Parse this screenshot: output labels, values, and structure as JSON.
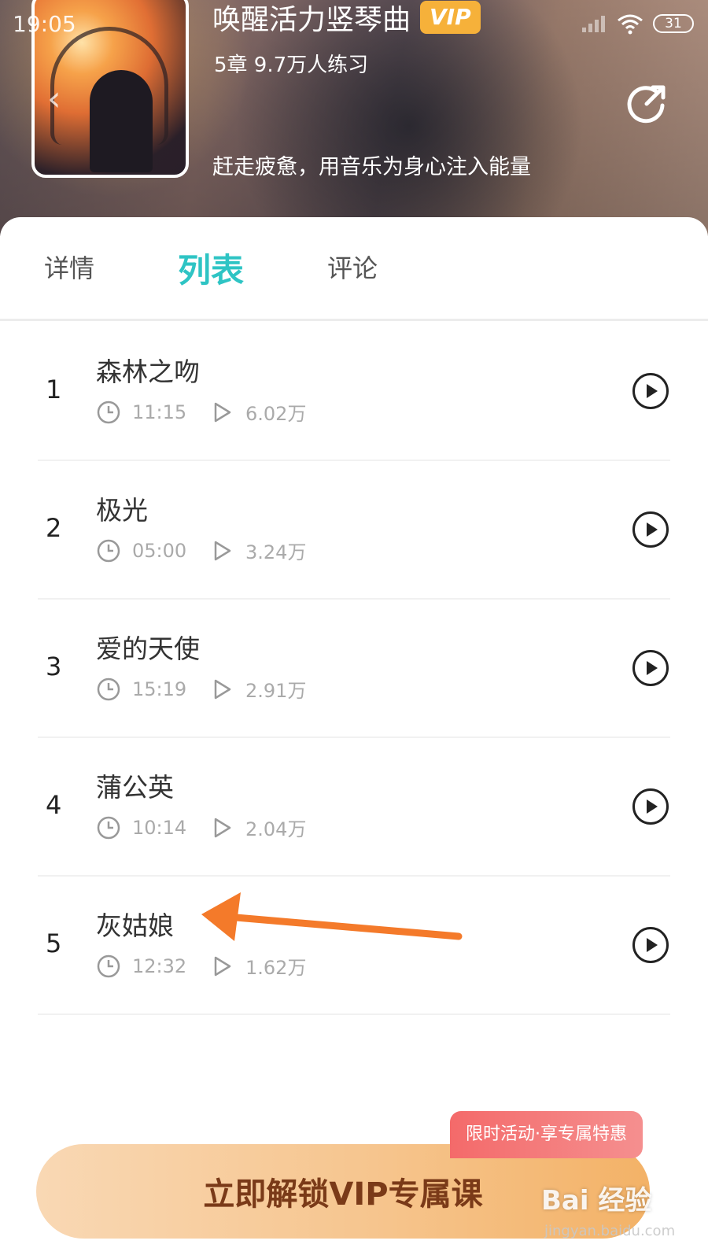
{
  "status_bar": {
    "time": "19:05",
    "battery": "31"
  },
  "header": {
    "title": "唤醒活力竖琴曲",
    "vip_label": "VIP",
    "meta": "5章 9.7万人练习",
    "description": "赶走疲惫，用音乐为身心注入能量"
  },
  "tabs": [
    {
      "label": "详情",
      "active": false
    },
    {
      "label": "列表",
      "active": true
    },
    {
      "label": "评论",
      "active": false
    }
  ],
  "tracks": [
    {
      "index": "1",
      "title": "森林之吻",
      "duration": "11:15",
      "plays": "6.02万"
    },
    {
      "index": "2",
      "title": "极光",
      "duration": "05:00",
      "plays": "3.24万"
    },
    {
      "index": "3",
      "title": "爱的天使",
      "duration": "15:19",
      "plays": "2.91万"
    },
    {
      "index": "4",
      "title": "蒲公英",
      "duration": "10:14",
      "plays": "2.04万"
    },
    {
      "index": "5",
      "title": "灰姑娘",
      "duration": "12:32",
      "plays": "1.62万"
    }
  ],
  "promo": {
    "tag": "限时活动·享专属特惠",
    "cta": "立即解锁VIP专属课"
  },
  "watermark": {
    "brand": "Bai 经验",
    "url": "jingyan.baidu.com"
  },
  "colors": {
    "accent": "#2ec4c4",
    "annotation_arrow": "#f47a2a",
    "vip": "#f6b13a",
    "promo": "#f46a6a"
  }
}
